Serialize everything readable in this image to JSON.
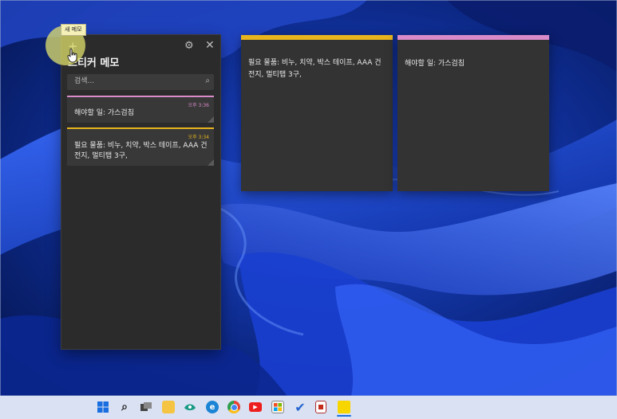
{
  "tooltip": "새 메모",
  "window": {
    "title": "스티커 메모",
    "search_placeholder": "검색..."
  },
  "notes": [
    {
      "time": "오후 3:36",
      "color": "#d88bc8",
      "text": "해야할 일: 가스검침"
    },
    {
      "time": "오후 3:34",
      "color": "#e8b51e",
      "text": "필요 물품: 비누, 치약, 박스 테이프, AAA 건전지, 멀티탭 3구,"
    }
  ],
  "open_notes": [
    {
      "color": "#e8b51e",
      "text": "필요 물품: 비누, 치약, 박스 테이프, AAA 건전지, 멀티탭 3구,"
    },
    {
      "color": "#d88bc8",
      "text": "해야할 일: 가스검침"
    }
  ],
  "taskbar": {
    "icons": [
      "windows-start-icon",
      "search-icon",
      "task-view-icon",
      "file-explorer-icon",
      "widgets-icon",
      "edge-icon",
      "chrome-icon",
      "youtube-icon",
      "store-icon",
      "todo-icon",
      "snipping-icon",
      "sticky-notes-icon"
    ]
  }
}
